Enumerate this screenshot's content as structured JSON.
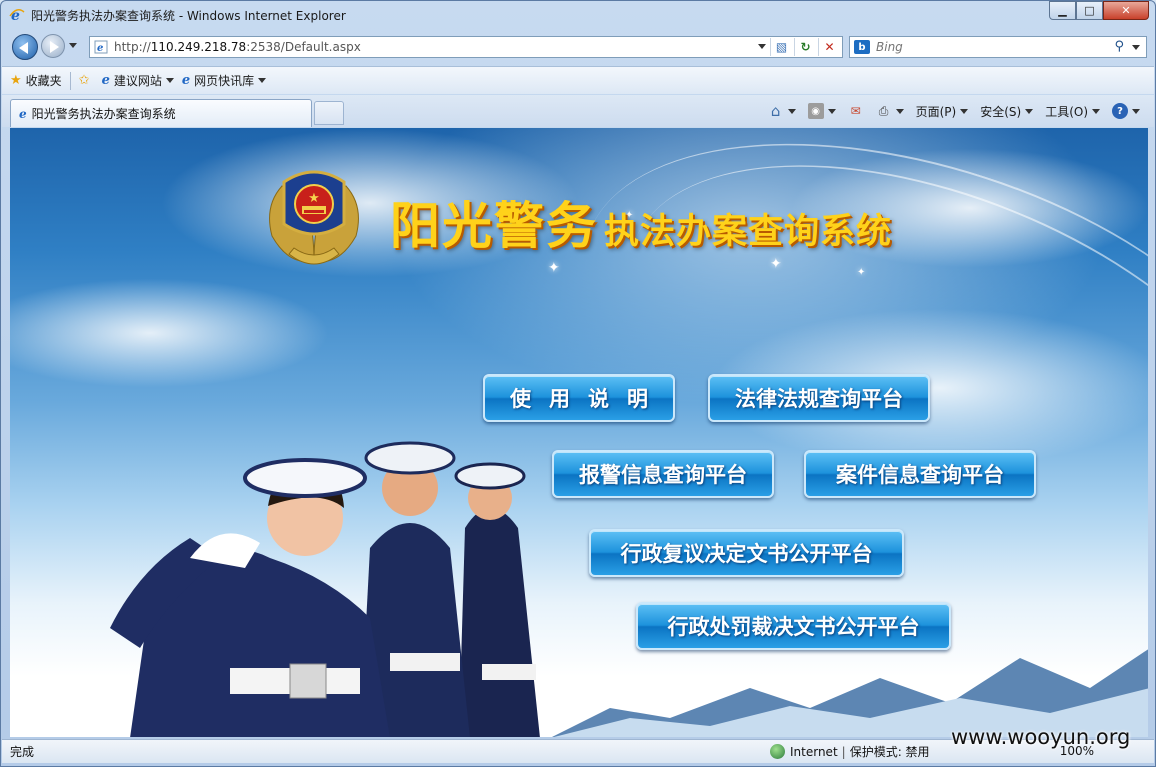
{
  "window": {
    "title": "阳光警务执法办案查询系统 - Windows Internet Explorer",
    "minimize_label": "▁",
    "maximize_label": "□",
    "close_label": "✕"
  },
  "address": {
    "url_prefix": "http://",
    "url_host": "110.249.218.78",
    "url_rest": ":2538/Default.aspx"
  },
  "search": {
    "engine_icon": "b",
    "placeholder": "Bing"
  },
  "favorites": {
    "favorites_label": "收藏夹",
    "items": [
      {
        "label": "建议网站"
      },
      {
        "label": "网页快讯库"
      }
    ]
  },
  "tab": {
    "label": "阳光警务执法办案查询系统"
  },
  "commands": {
    "page": "页面(P)",
    "safety": "安全(S)",
    "tools": "工具(O)"
  },
  "site": {
    "title_large": "阳光警务",
    "title_small": "执法办案查询系统"
  },
  "menu_buttons": [
    {
      "label": "使用说明"
    },
    {
      "label": "法律法规查询平台"
    },
    {
      "label": "报警信息查询平台"
    },
    {
      "label": "案件信息查询平台"
    },
    {
      "label": "行政复议决定文书公开平台"
    },
    {
      "label": "行政处罚裁决文书公开平台"
    }
  ],
  "status": {
    "text": "完成",
    "zone": "Internet",
    "protected_mode": "保护模式: 禁用",
    "zoom": "100%"
  },
  "watermark": "www.wooyun.org",
  "colors": {
    "title_gold": "#ffd21a",
    "button_blue": "#1d92dc",
    "sky_blue": "#2f7fc4"
  }
}
